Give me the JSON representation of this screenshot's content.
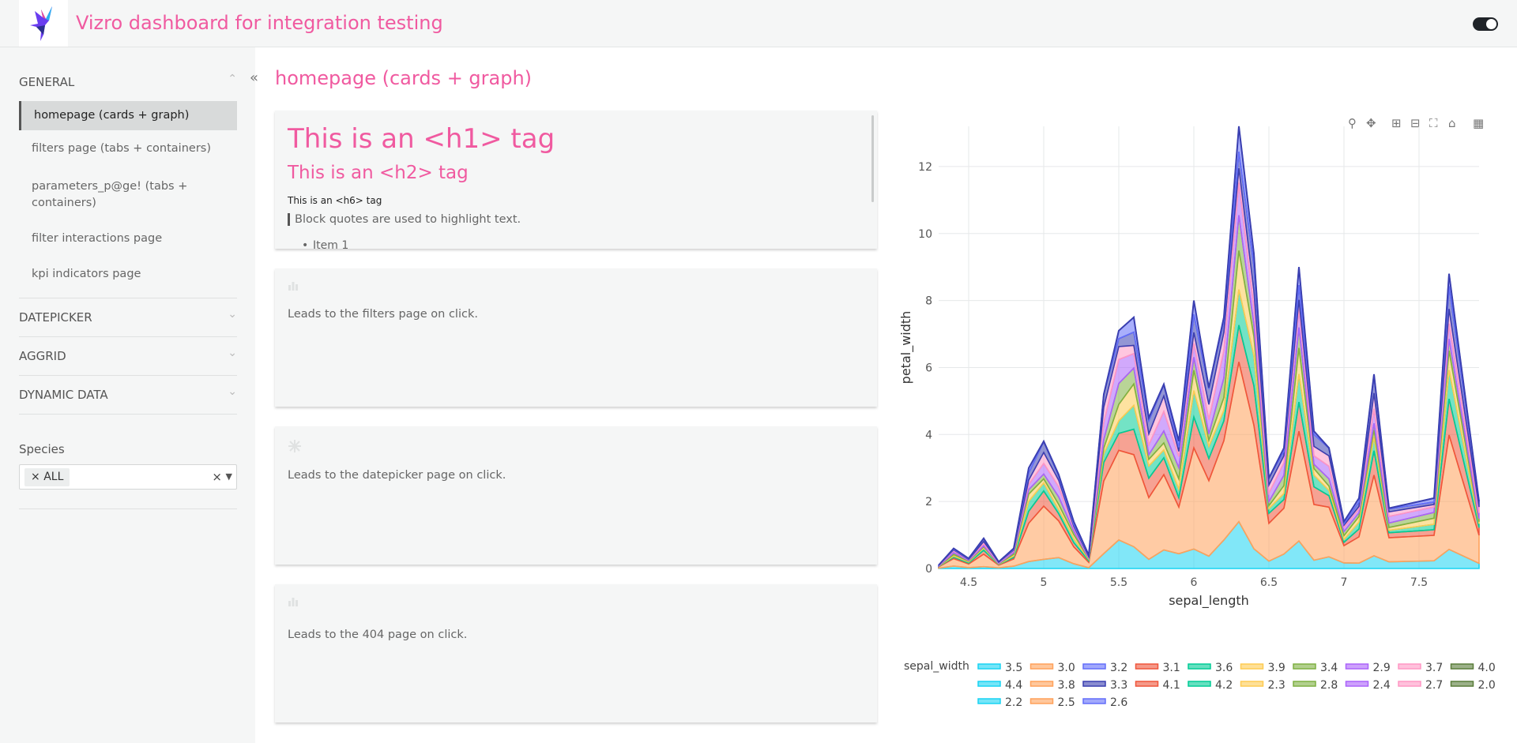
{
  "header": {
    "title": "Vizro dashboard for integration testing"
  },
  "sidebar": {
    "groups": [
      {
        "label": "GENERAL",
        "expanded": true
      },
      {
        "label": "DATEPICKER",
        "expanded": false
      },
      {
        "label": "AGGRID",
        "expanded": false
      },
      {
        "label": "DYNAMIC DATA",
        "expanded": false
      }
    ],
    "pages": [
      {
        "label": "homepage (cards + graph)",
        "active": true
      },
      {
        "label": "filters page (tabs + containers)",
        "active": false
      },
      {
        "label": "parameters_p@ge! (tabs +",
        "label2": "containers)",
        "active": false
      },
      {
        "label": "filter interactions page",
        "active": false
      },
      {
        "label": "kpi indicators page",
        "active": false
      }
    ],
    "filter": {
      "label": "Species",
      "selected": "ALL",
      "clear_glyph": "×",
      "chip_remove_glyph": "×"
    }
  },
  "page": {
    "title": "homepage (cards + graph)",
    "collapse_glyph": "«"
  },
  "cards": {
    "text_card": {
      "h1": "This is an <h1> tag",
      "h2": "This is an <h2> tag",
      "h6": "This is an <h6> tag",
      "blockquote": "Block quotes are used to highlight text.",
      "list_item": "Item 1"
    },
    "nav_cards": [
      {
        "icon": "bar-chart-icon",
        "text": "Leads to the filters page on click."
      },
      {
        "icon": "snowflake-icon",
        "text": "Leads to the datepicker page on click."
      },
      {
        "icon": "bar-chart-icon",
        "text": "Leads to the 404 page on click."
      }
    ]
  },
  "chart_data": {
    "type": "area",
    "title": "",
    "xlabel": "sepal_length",
    "ylabel": "petal_width",
    "xlim": [
      4.3,
      7.9
    ],
    "ylim": [
      0,
      13.2
    ],
    "xticks": [
      4.5,
      5,
      5.5,
      6,
      6.5,
      7,
      7.5
    ],
    "yticks": [
      0,
      2,
      4,
      6,
      8,
      10,
      12
    ],
    "grid": true,
    "legend_title": "sepal_width",
    "legend_placement": "bottom",
    "x": [
      4.3,
      4.4,
      4.5,
      4.6,
      4.7,
      4.8,
      4.9,
      5.0,
      5.1,
      5.2,
      5.3,
      5.4,
      5.5,
      5.6,
      5.7,
      5.8,
      5.9,
      6.0,
      6.1,
      6.2,
      6.3,
      6.4,
      6.5,
      6.6,
      6.7,
      6.8,
      6.9,
      7.0,
      7.1,
      7.2,
      7.3,
      7.6,
      7.7,
      7.9
    ],
    "top_envelope": [
      0.1,
      0.6,
      0.3,
      0.9,
      0.2,
      0.6,
      3.0,
      3.8,
      2.8,
      1.4,
      0.4,
      5.2,
      7.1,
      7.5,
      4.5,
      5.5,
      3.8,
      8.0,
      5.4,
      7.5,
      13.2,
      9.4,
      2.7,
      3.6,
      9.0,
      4.1,
      3.6,
      1.4,
      2.1,
      5.8,
      1.8,
      2.1,
      8.8,
      2.0
    ],
    "series": [
      {
        "name": "3.5",
        "color": "#19d3f3"
      },
      {
        "name": "3.0",
        "color": "#ffa15a"
      },
      {
        "name": "3.2",
        "color": "#636efa"
      },
      {
        "name": "3.1",
        "color": "#ef553b"
      },
      {
        "name": "3.6",
        "color": "#00cc96"
      },
      {
        "name": "3.9",
        "color": "#fecb52"
      },
      {
        "name": "3.4",
        "color": "#7fb042"
      },
      {
        "name": "2.9",
        "color": "#ab63fa"
      },
      {
        "name": "3.7",
        "color": "#ff97c4"
      },
      {
        "name": "4.0",
        "color": "#5a7d3a"
      },
      {
        "name": "4.4",
        "color": "#19d3f3"
      },
      {
        "name": "3.8",
        "color": "#ffa15a"
      },
      {
        "name": "3.3",
        "color": "#3a3fb0"
      },
      {
        "name": "4.1",
        "color": "#ef553b"
      },
      {
        "name": "4.2",
        "color": "#00cc96"
      },
      {
        "name": "2.3",
        "color": "#fecb52"
      },
      {
        "name": "2.8",
        "color": "#7fb042"
      },
      {
        "name": "2.4",
        "color": "#ab63fa"
      },
      {
        "name": "2.7",
        "color": "#ff97c4"
      },
      {
        "name": "2.0",
        "color": "#5a7d3a"
      },
      {
        "name": "2.2",
        "color": "#19d3f3"
      },
      {
        "name": "2.5",
        "color": "#ffa15a"
      },
      {
        "name": "2.6",
        "color": "#636efa"
      }
    ]
  }
}
